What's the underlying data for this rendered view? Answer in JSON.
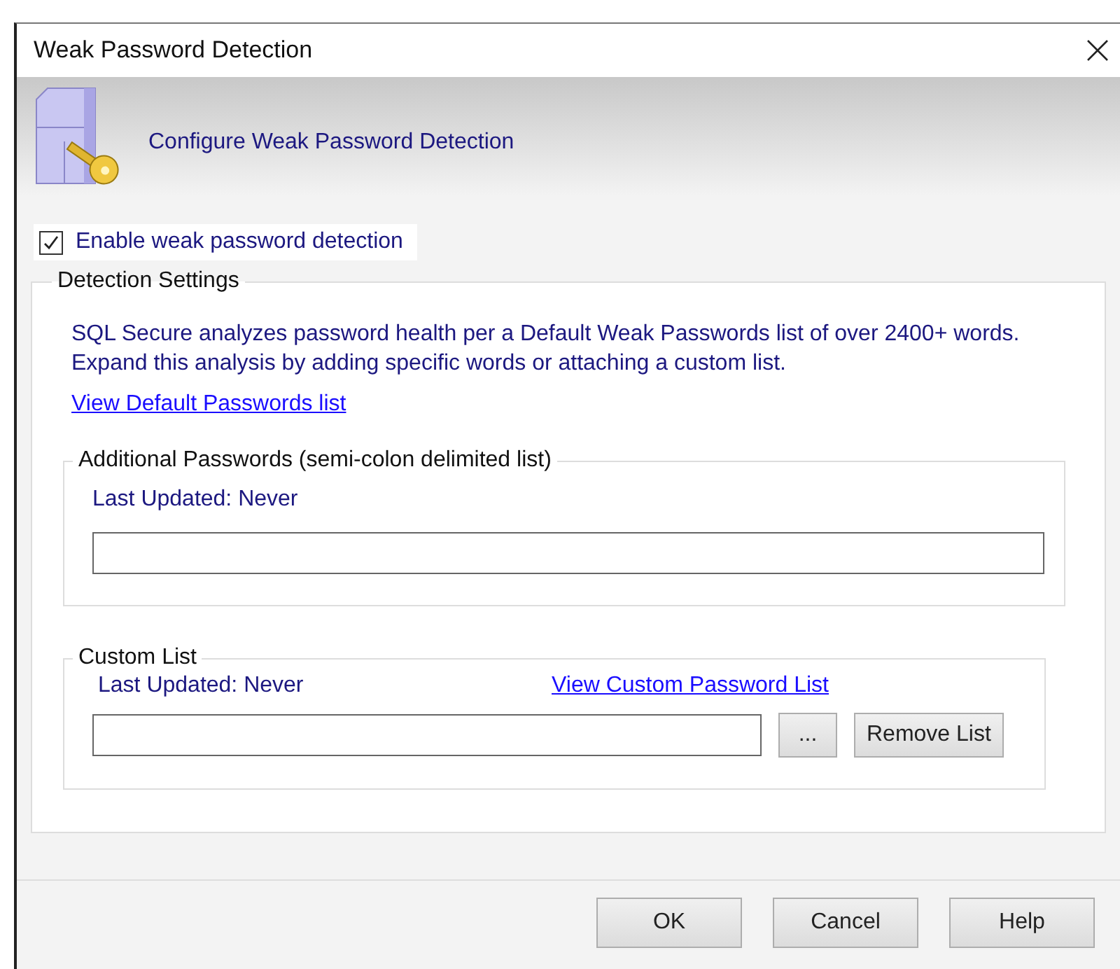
{
  "window": {
    "title": "Weak Password Detection"
  },
  "header": {
    "title": "Configure Weak Password Detection"
  },
  "enable_checkbox": {
    "label": "Enable weak password detection",
    "checked": true
  },
  "detection_settings": {
    "title": "Detection Settings",
    "description": "SQL Secure analyzes password health per a Default Weak Passwords list of over 2400+ words. Expand this analysis by adding specific words or attaching a custom list.",
    "link": "View Default Passwords list",
    "additional_passwords": {
      "title": "Additional Passwords (semi-colon delimited list)",
      "last_updated": "Last Updated: Never"
    },
    "custom_list": {
      "title": "Custom List",
      "last_updated": "Last Updated: Never",
      "link": "View Custom Password List",
      "browse_button": "...",
      "remove_button": "Remove List"
    }
  },
  "buttons": [
    "OK",
    "Cancel",
    "Help"
  ]
}
